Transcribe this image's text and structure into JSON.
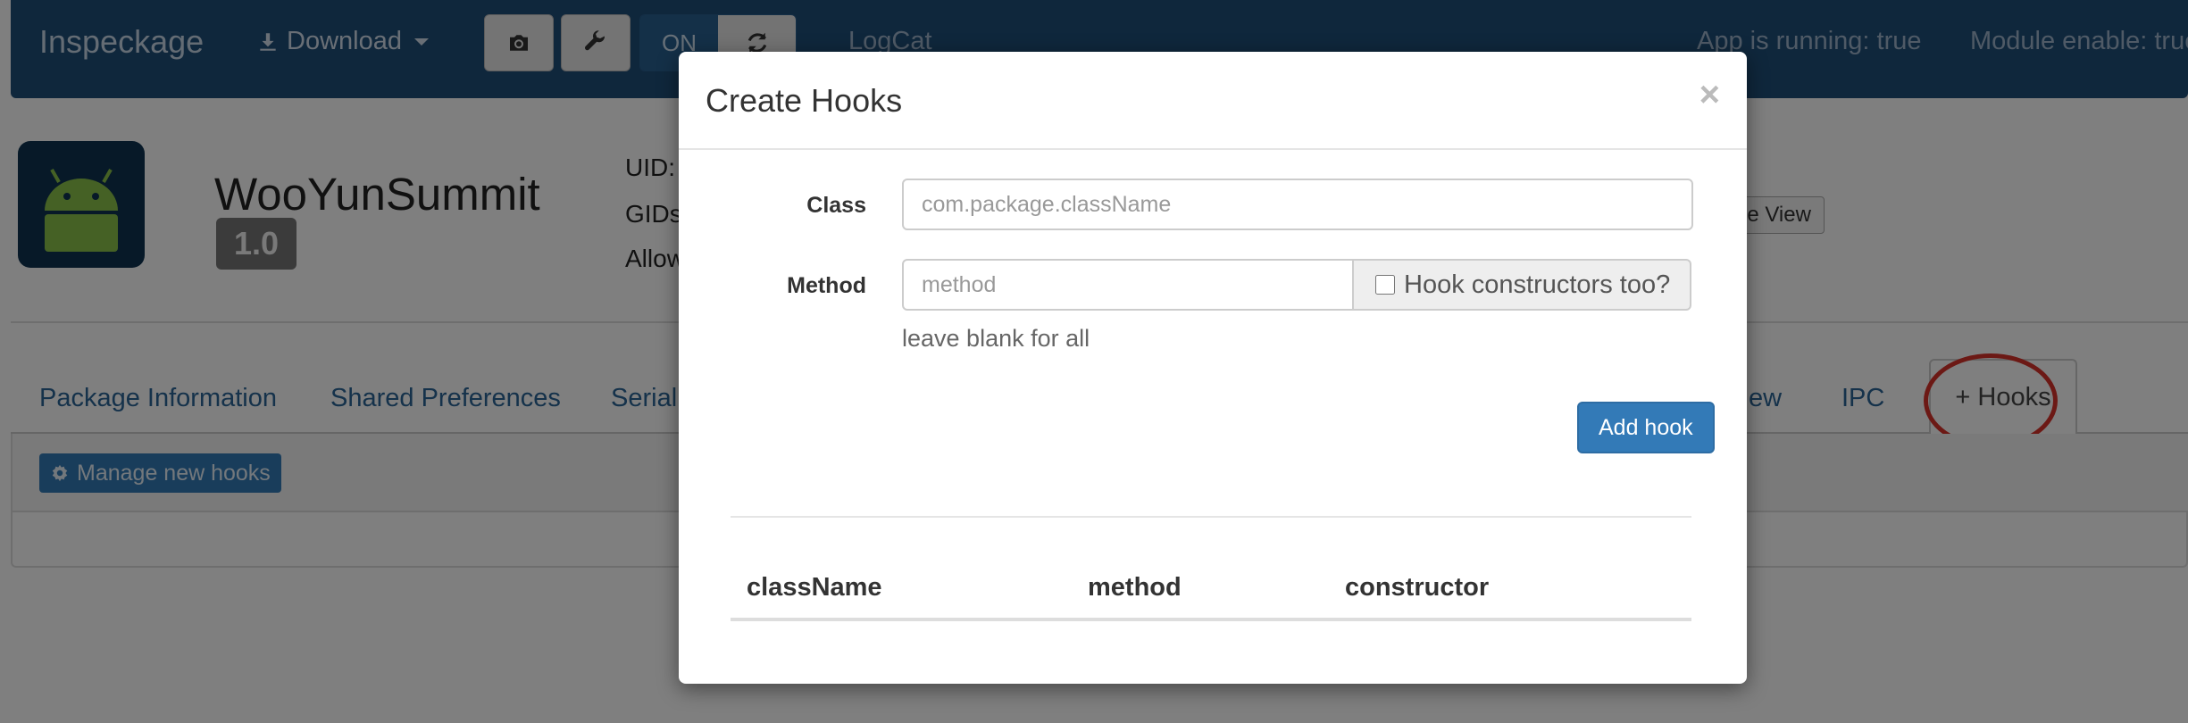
{
  "navbar": {
    "brand": "Inspeckage",
    "download_label": "Download",
    "toggle_on": "ON",
    "logcat": "LogCat",
    "app_running": "App is running: true",
    "module_enable": "Module enable: true"
  },
  "app": {
    "name": "WooYunSummit",
    "version": "1.0",
    "uid_label": "UID:",
    "gids_label": "GIDs",
    "allow_label": "Allow",
    "tree_view": "ree View"
  },
  "tabs": {
    "package_info": "Package Information",
    "shared_prefs": "Shared Preferences",
    "serial": "Seriali",
    "webview": "ew",
    "ipc": "IPC",
    "hooks": "+ Hooks"
  },
  "panel": {
    "manage_hooks": "Manage new hooks"
  },
  "modal": {
    "title": "Create Hooks",
    "close": "×",
    "class_label": "Class",
    "class_placeholder": "com.package.className",
    "method_label": "Method",
    "method_placeholder": "method",
    "constructors_label": "Hook constructors too?",
    "help": "leave blank for all",
    "add_hook": "Add hook",
    "table_headers": [
      "className",
      "method",
      "constructor"
    ]
  },
  "colors": {
    "navbar": "#1f4e79",
    "primary": "#337ab7",
    "highlight_ring": "#d9332b"
  }
}
